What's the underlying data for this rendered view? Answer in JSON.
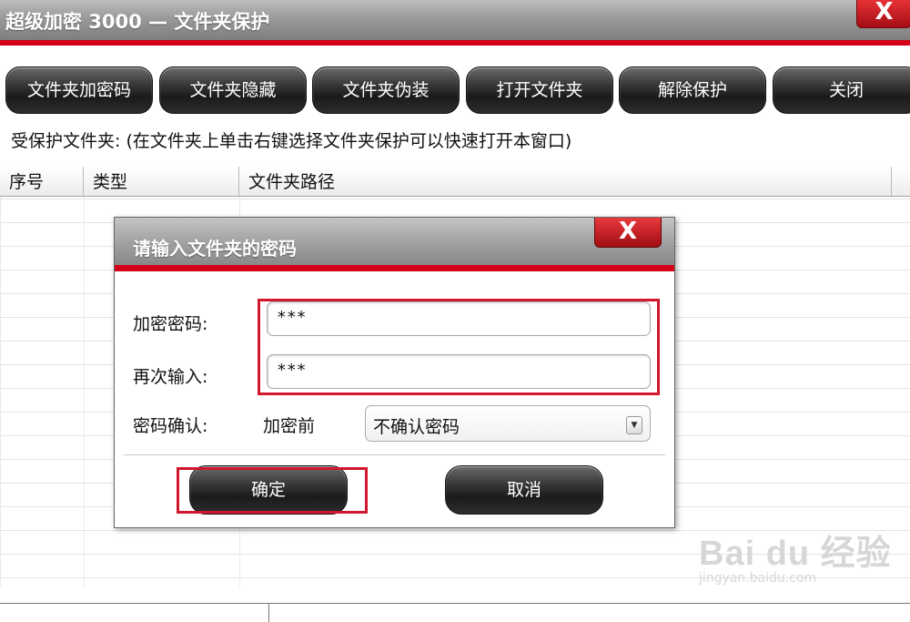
{
  "window": {
    "title": "超级加密 3000 — 文件夹保护",
    "close_label": "X"
  },
  "toolbar": {
    "buttons": [
      {
        "label": "文件夹加密码"
      },
      {
        "label": "文件夹隐藏"
      },
      {
        "label": "文件夹伪装"
      },
      {
        "label": "打开文件夹"
      },
      {
        "label": "解除保护"
      },
      {
        "label": "关闭"
      }
    ]
  },
  "hint": "受保护文件夹: (在文件夹上单击右键选择文件夹保护可以快速打开本窗口)",
  "table": {
    "columns": [
      "序号",
      "类型",
      "文件夹路径"
    ]
  },
  "dialog": {
    "title": "请输入文件夹的密码",
    "close_label": "X",
    "password_label": "加密密码:",
    "password_value": "***",
    "repeat_label": "再次输入:",
    "repeat_value": "***",
    "confirm_label": "密码确认:",
    "confirm_when": "加密前",
    "confirm_select_value": "不确认密码",
    "ok_label": "确定",
    "cancel_label": "取消"
  },
  "watermark": {
    "brand": "Bai du 经验",
    "url": "jingyan.baidu.com"
  },
  "colors": {
    "accent_red": "#d4001a",
    "highlight_red": "#d1172c",
    "button_dark": "#1a1a1a"
  }
}
